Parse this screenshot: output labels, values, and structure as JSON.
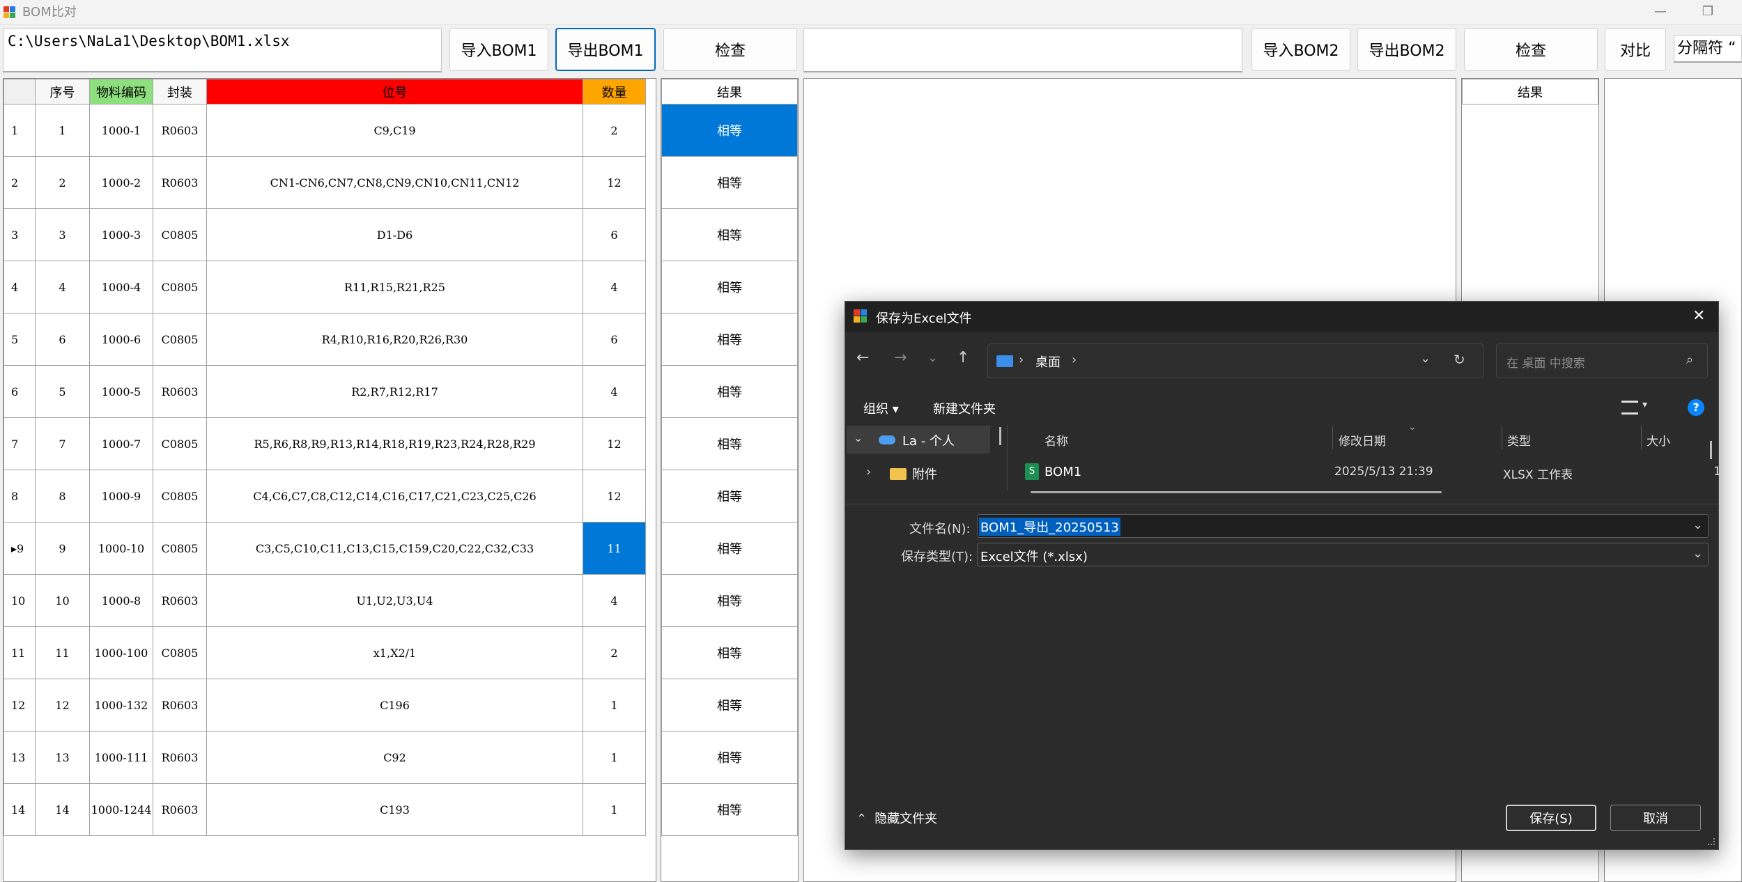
{
  "window": {
    "title": "BOM比对",
    "minimize": "—",
    "restore": "❐"
  },
  "toolbar": {
    "path1": "C:\\Users\\NaLa1\\Desktop\\BOM1.xlsx",
    "import_bom1": "导入BOM1",
    "export_bom1": "导出BOM1",
    "check1": "检查",
    "path2": "",
    "import_bom2": "导入BOM2",
    "export_bom2": "导出BOM2",
    "check2": "检查",
    "compare": "对比",
    "separator": "分隔符 “"
  },
  "grid1": {
    "headers": [
      "序号",
      "物料编码",
      "封装",
      "位号",
      "数量"
    ],
    "header_colors": {
      "code": "#8ee07f",
      "ref": "#ff0000",
      "qty": "#ffa500"
    },
    "rows": [
      {
        "n": "1",
        "seq": "1",
        "code": "1000-1",
        "pkg": "R0603",
        "ref": "C9,C19",
        "qty": "2"
      },
      {
        "n": "2",
        "seq": "2",
        "code": "1000-2",
        "pkg": "R0603",
        "ref": "CN1-CN6,CN7,CN8,CN9,CN10,CN11,CN12",
        "qty": "12"
      },
      {
        "n": "3",
        "seq": "3",
        "code": "1000-3",
        "pkg": "C0805",
        "ref": "D1-D6",
        "qty": "6"
      },
      {
        "n": "4",
        "seq": "4",
        "code": "1000-4",
        "pkg": "C0805",
        "ref": "R11,R15,R21,R25",
        "qty": "4"
      },
      {
        "n": "5",
        "seq": "6",
        "code": "1000-6",
        "pkg": "C0805",
        "ref": "R4,R10,R16,R20,R26,R30",
        "qty": "6"
      },
      {
        "n": "6",
        "seq": "5",
        "code": "1000-5",
        "pkg": "R0603",
        "ref": "R2,R7,R12,R17",
        "qty": "4"
      },
      {
        "n": "7",
        "seq": "7",
        "code": "1000-7",
        "pkg": "C0805",
        "ref": "R5,R6,R8,R9,R13,R14,R18,R19,R23,R24,R28,R29",
        "qty": "12"
      },
      {
        "n": "8",
        "seq": "8",
        "code": "1000-9",
        "pkg": "C0805",
        "ref": "C4,C6,C7,C8,C12,C14,C16,C17,C21,C23,C25,C26",
        "qty": "12"
      },
      {
        "n": "▸9",
        "seq": "9",
        "code": "1000-10",
        "pkg": "C0805",
        "ref": "C3,C5,C10,C11,C13,C15,C159,C20,C22,C32,C33",
        "qty": "11"
      },
      {
        "n": "10",
        "seq": "10",
        "code": "1000-8",
        "pkg": "R0603",
        "ref": "U1,U2,U3,U4",
        "qty": "4"
      },
      {
        "n": "11",
        "seq": "11",
        "code": "1000-100",
        "pkg": "C0805",
        "ref": "x1,X2/1",
        "qty": "2"
      },
      {
        "n": "12",
        "seq": "12",
        "code": "1000-132",
        "pkg": "R0603",
        "ref": "C196",
        "qty": "1"
      },
      {
        "n": "13",
        "seq": "13",
        "code": "1000-111",
        "pkg": "R0603",
        "ref": "C92",
        "qty": "1"
      },
      {
        "n": "14",
        "seq": "14",
        "code": "1000-1244",
        "pkg": "R0603",
        "ref": "C193",
        "qty": "1"
      }
    ]
  },
  "result1": {
    "header": "结果",
    "rows": [
      "相等",
      "相等",
      "相等",
      "相等",
      "相等",
      "相等",
      "相等",
      "相等",
      "相等",
      "相等",
      "相等",
      "相等",
      "相等",
      "相等"
    ]
  },
  "result2": {
    "header": "结果"
  },
  "selection_color": "#0078d7",
  "dialog": {
    "title": "保存为Excel文件",
    "close": "✕",
    "breadcrumb": "桌面",
    "search_placeholder": "在 桌面 中搜索",
    "organize": "组织 ▾",
    "new_folder": "新建文件夹",
    "nav_tree": [
      {
        "label": "La - 个人"
      },
      {
        "label": "附件"
      }
    ],
    "columns": [
      "名称",
      "修改日期",
      "类型",
      "大小"
    ],
    "files": [
      {
        "name": "BOM1",
        "date": "2025/5/13 21:39",
        "type": "XLSX 工作表",
        "size": "1"
      }
    ],
    "filename_label": "文件名(N):",
    "filename_value": "BOM1_导出_20250513",
    "filetype_label": "保存类型(T):",
    "filetype_value": "Excel文件 (*.xlsx)",
    "hide_folders": "隐藏文件夹",
    "save": "保存(S)",
    "cancel": "取消"
  }
}
